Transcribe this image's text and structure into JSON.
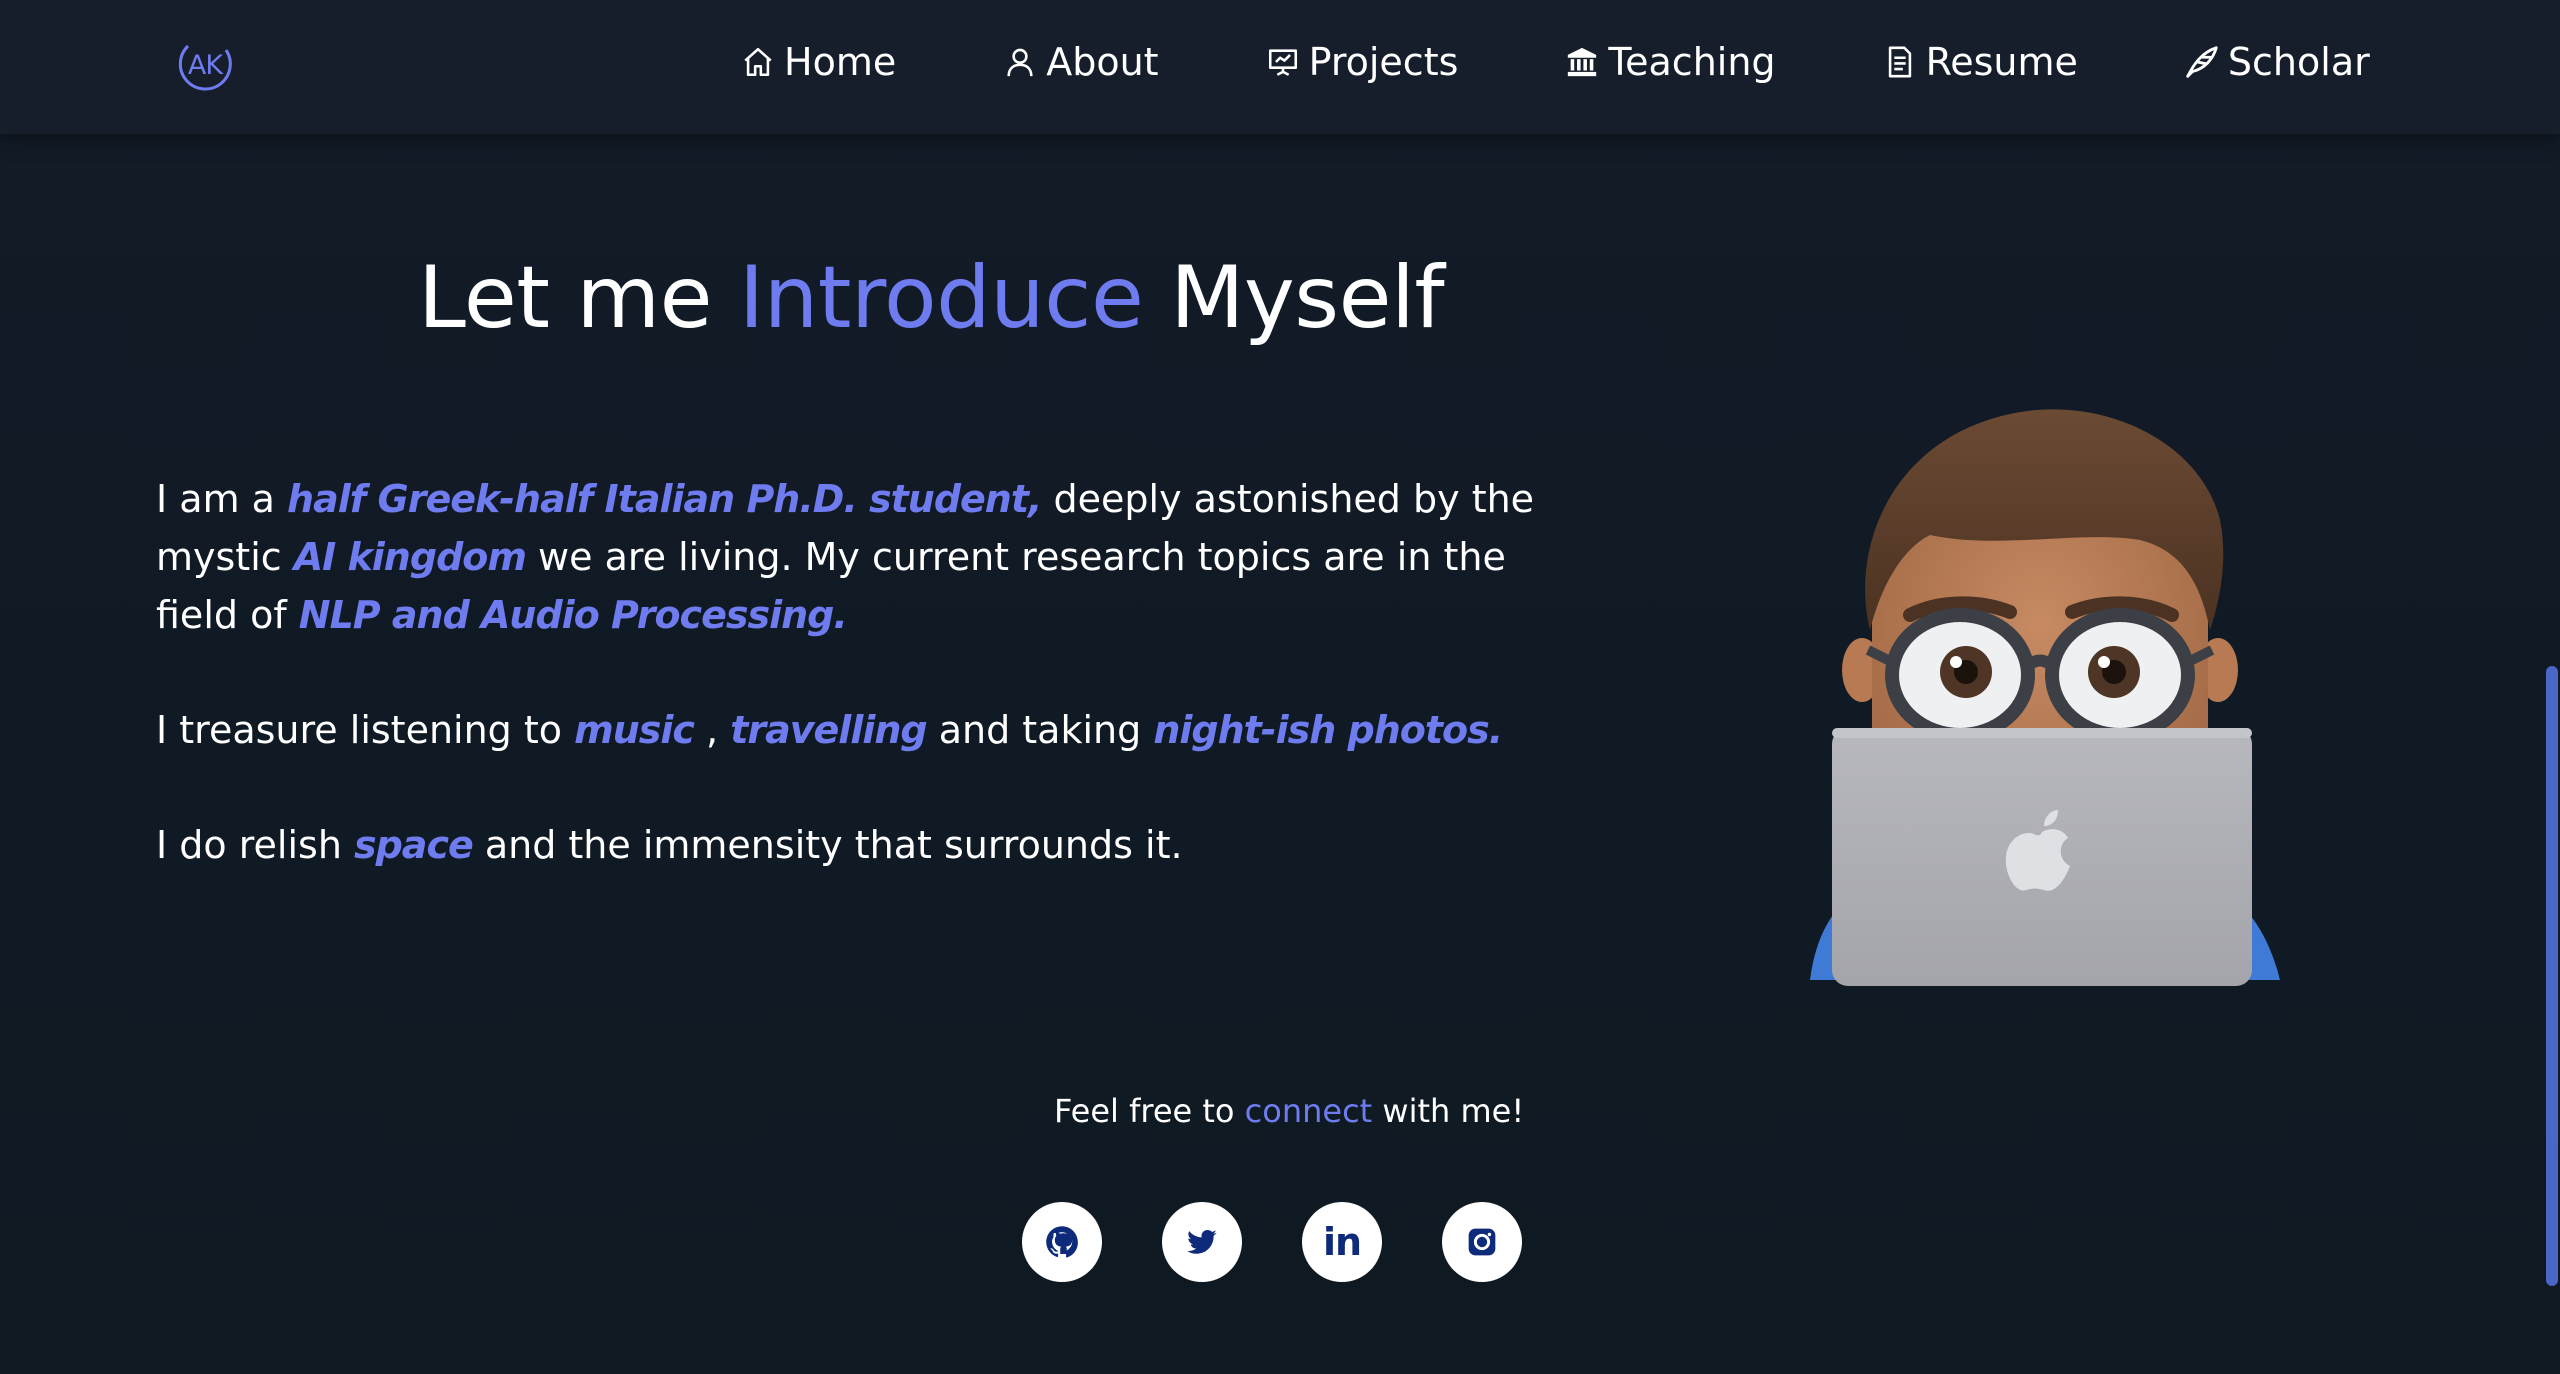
{
  "brand": {
    "logo_text": "AK",
    "accent_color": "#6f7cf0"
  },
  "nav": {
    "items": [
      {
        "label": "Home",
        "icon": "home-icon"
      },
      {
        "label": "About",
        "icon": "user-icon"
      },
      {
        "label": "Projects",
        "icon": "presentation-icon"
      },
      {
        "label": "Teaching",
        "icon": "institution-icon"
      },
      {
        "label": "Resume",
        "icon": "document-icon"
      },
      {
        "label": "Scholar",
        "icon": "quill-icon"
      }
    ]
  },
  "heading": {
    "part1": "Let me ",
    "highlight": "Introduce",
    "part2": " Myself"
  },
  "about": {
    "p1": {
      "t1": "I am a ",
      "h1": "half Greek-half Italian Ph.D. student,",
      "t2": " deeply astonished by the mystic ",
      "h2": "AI kingdom",
      "t3": " we are living. My current research topics are in the field of ",
      "h3": "NLP and Audio Processing."
    },
    "p2": {
      "t1": "I treasure listening to ",
      "h1": "music",
      "t2": " , ",
      "h2": "travelling",
      "t3": " and taking ",
      "h3": "night-ish photos."
    },
    "p3": {
      "t1": "I do relish ",
      "h1": "space",
      "t2": " and the immensity that surrounds it."
    }
  },
  "connect": {
    "t1": "Feel free to ",
    "link": "connect",
    "t2": " with me!"
  },
  "socials": [
    {
      "name": "github",
      "icon": "github-icon"
    },
    {
      "name": "twitter",
      "icon": "twitter-icon"
    },
    {
      "name": "linkedin",
      "icon": "linkedin-icon",
      "text": "in"
    },
    {
      "name": "instagram",
      "icon": "instagram-icon"
    }
  ]
}
